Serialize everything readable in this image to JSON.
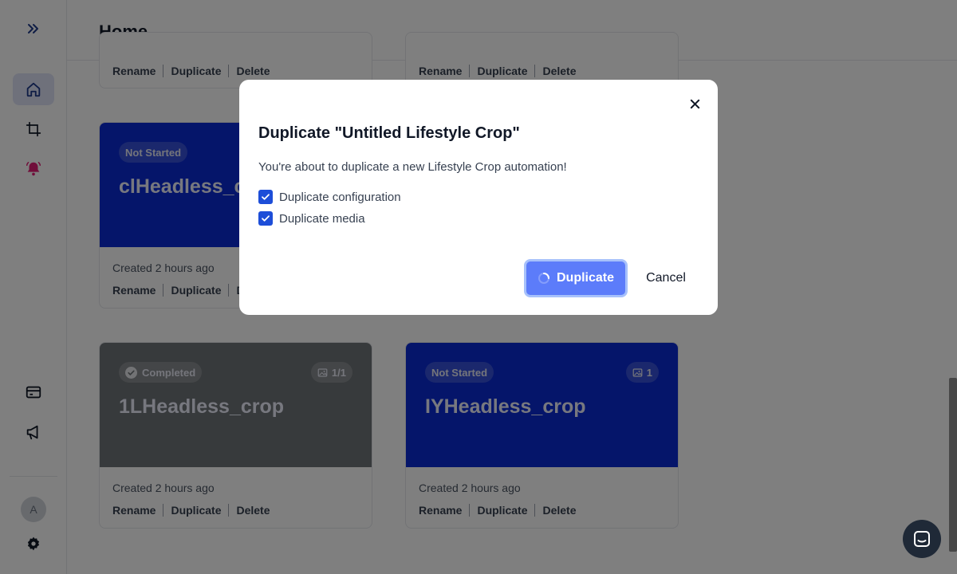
{
  "header": {
    "title": "Home"
  },
  "sidebar": {
    "icons": [
      "expand-icon",
      "home-icon",
      "crop-icon",
      "notification-bell-icon",
      "credit-card-icon",
      "megaphone-icon",
      "settings-gear-icon"
    ],
    "avatar_initial": "A"
  },
  "cards": [
    {
      "status": "",
      "name": "",
      "created": "",
      "actions": [
        "Rename",
        "Duplicate",
        "Delete"
      ]
    },
    {
      "status": "",
      "name": "",
      "created": "",
      "actions": [
        "Rename",
        "Duplicate",
        "Delete"
      ]
    },
    {
      "status": "Not Started",
      "name": "clHeadless_crop",
      "created": "Created 2 hours ago",
      "actions": [
        "Rename",
        "Duplicate",
        "Delete"
      ]
    },
    {
      "status": "Completed",
      "count": "1/1",
      "name": "1LHeadless_crop",
      "created": "Created 2 hours ago",
      "actions": [
        "Rename",
        "Duplicate",
        "Delete"
      ]
    },
    {
      "status": "Not Started",
      "count": "1",
      "name": "IYHeadless_crop",
      "created": "Created 2 hours ago",
      "actions": [
        "Rename",
        "Duplicate",
        "Delete"
      ]
    }
  ],
  "modal": {
    "title": "Duplicate \"Untitled Lifestyle Crop\"",
    "description": "You're about to duplicate a new Lifestyle Crop automation!",
    "options": [
      {
        "label": "Duplicate configuration",
        "checked": true
      },
      {
        "label": "Duplicate media",
        "checked": true
      }
    ],
    "primary_label": "Duplicate",
    "cancel_label": "Cancel"
  },
  "colors": {
    "card_blue": "#0a2ad4",
    "card_gray": "#6f7478",
    "primary_button": "#5c7cfa",
    "checkbox": "#1d4ed8",
    "notification": "#e11d74"
  }
}
